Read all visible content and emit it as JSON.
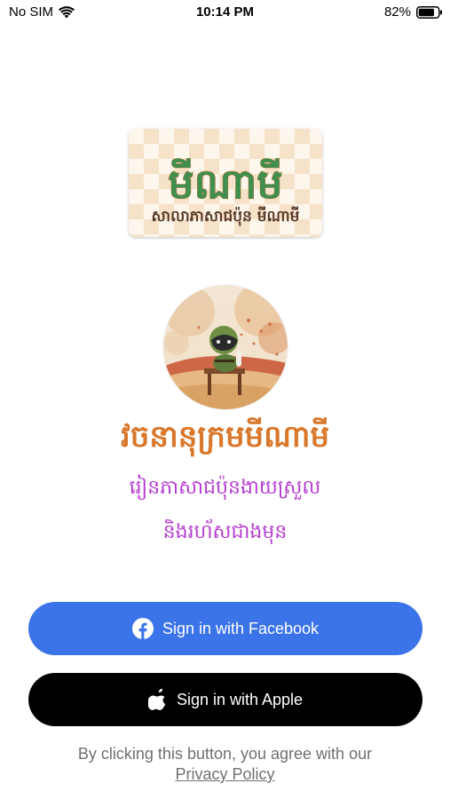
{
  "status_bar": {
    "carrier": "No SIM",
    "time": "10:14 PM",
    "battery": "82%",
    "battery_level": 0.82,
    "icons": [
      "wifi-icon",
      "battery-icon"
    ]
  },
  "logo": {
    "title": "មីណាមី",
    "subtitle": "សាលាភាសាជប៉ុន មីណាមី"
  },
  "app": {
    "title": "វចនានុក្រមមីណាមី",
    "subtitle_line1": "រៀនភាសាជប៉ុនងាយស្រួល",
    "subtitle_line2": "និងរហ័សជាងមុន"
  },
  "buttons": {
    "facebook_label": "Sign in with Facebook",
    "facebook_icon": "facebook-icon",
    "apple_label": "Sign in with Apple",
    "apple_icon": "apple-icon"
  },
  "disclaimer": {
    "text": "By clicking this button, you agree with our",
    "link": "Privacy Policy"
  },
  "colors": {
    "facebook_blue": "#3b73e8",
    "apple_black": "#000000",
    "title_orange": "#d9772b",
    "subtitle_purple": "#b43bd0",
    "disclaimer_gray": "#707070"
  }
}
